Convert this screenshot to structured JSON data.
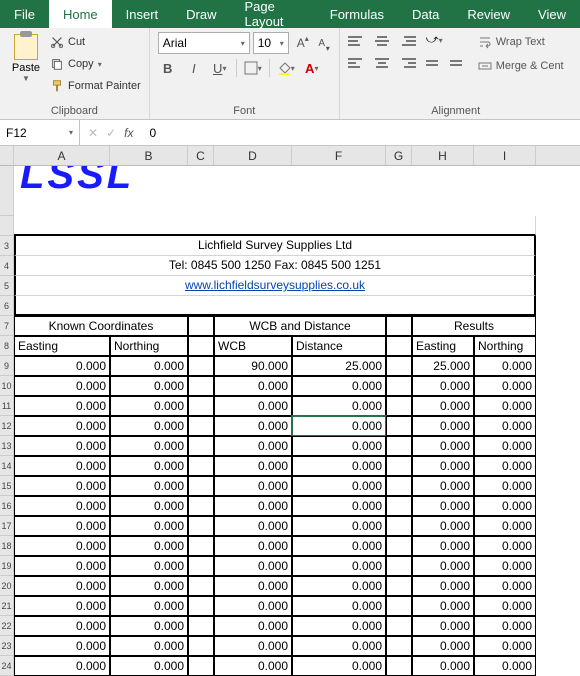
{
  "tabs": [
    "File",
    "Home",
    "Insert",
    "Draw",
    "Page Layout",
    "Formulas",
    "Data",
    "Review",
    "View"
  ],
  "active_tab": "Home",
  "clipboard": {
    "paste": "Paste",
    "cut": "Cut",
    "copy": "Copy",
    "format_painter": "Format Painter",
    "group": "Clipboard"
  },
  "font": {
    "name": "Arial",
    "size": "10",
    "group": "Font"
  },
  "alignment": {
    "wrap": "Wrap Text",
    "merge": "Merge & Cent",
    "group": "Alignment"
  },
  "namebox": "F12",
  "formula": "0",
  "cols": [
    "A",
    "B",
    "C",
    "D",
    "F",
    "G",
    "H",
    "I"
  ],
  "sheet": {
    "logo": "LSSL",
    "company": "Lichfield Survey Supplies Ltd",
    "contact": "Tel: 0845 500 1250  Fax: 0845 500 1251",
    "url": "www.lichfieldsurveysupplies.co.uk",
    "group_known": "Known Coordinates",
    "group_wcb": "WCB and Distance",
    "group_results": "Results",
    "hdr_easting": "Easting",
    "hdr_northing": "Northing",
    "hdr_wcb": "WCB",
    "hdr_distance": "Distance"
  },
  "rows": [
    {
      "ke": "0.000",
      "kn": "0.000",
      "w": "90.000",
      "d": "25.000",
      "re": "25.000",
      "rn": "0.000"
    },
    {
      "ke": "0.000",
      "kn": "0.000",
      "w": "0.000",
      "d": "0.000",
      "re": "0.000",
      "rn": "0.000"
    },
    {
      "ke": "0.000",
      "kn": "0.000",
      "w": "0.000",
      "d": "0.000",
      "re": "0.000",
      "rn": "0.000"
    },
    {
      "ke": "0.000",
      "kn": "0.000",
      "w": "0.000",
      "d": "0.000",
      "re": "0.000",
      "rn": "0.000"
    },
    {
      "ke": "0.000",
      "kn": "0.000",
      "w": "0.000",
      "d": "0.000",
      "re": "0.000",
      "rn": "0.000"
    },
    {
      "ke": "0.000",
      "kn": "0.000",
      "w": "0.000",
      "d": "0.000",
      "re": "0.000",
      "rn": "0.000"
    },
    {
      "ke": "0.000",
      "kn": "0.000",
      "w": "0.000",
      "d": "0.000",
      "re": "0.000",
      "rn": "0.000"
    },
    {
      "ke": "0.000",
      "kn": "0.000",
      "w": "0.000",
      "d": "0.000",
      "re": "0.000",
      "rn": "0.000"
    },
    {
      "ke": "0.000",
      "kn": "0.000",
      "w": "0.000",
      "d": "0.000",
      "re": "0.000",
      "rn": "0.000"
    },
    {
      "ke": "0.000",
      "kn": "0.000",
      "w": "0.000",
      "d": "0.000",
      "re": "0.000",
      "rn": "0.000"
    },
    {
      "ke": "0.000",
      "kn": "0.000",
      "w": "0.000",
      "d": "0.000",
      "re": "0.000",
      "rn": "0.000"
    },
    {
      "ke": "0.000",
      "kn": "0.000",
      "w": "0.000",
      "d": "0.000",
      "re": "0.000",
      "rn": "0.000"
    },
    {
      "ke": "0.000",
      "kn": "0.000",
      "w": "0.000",
      "d": "0.000",
      "re": "0.000",
      "rn": "0.000"
    },
    {
      "ke": "0.000",
      "kn": "0.000",
      "w": "0.000",
      "d": "0.000",
      "re": "0.000",
      "rn": "0.000"
    },
    {
      "ke": "0.000",
      "kn": "0.000",
      "w": "0.000",
      "d": "0.000",
      "re": "0.000",
      "rn": "0.000"
    },
    {
      "ke": "0.000",
      "kn": "0.000",
      "w": "0.000",
      "d": "0.000",
      "re": "0.000",
      "rn": "0.000"
    }
  ]
}
